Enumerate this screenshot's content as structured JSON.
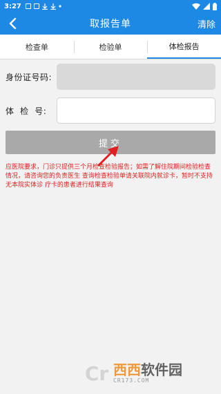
{
  "status_bar": {
    "time": "3:27",
    "left_icons": [
      "sim-icon",
      "sim-icon",
      "download-icon",
      "download-icon",
      "dot-icon"
    ],
    "right_icons": [
      "wifi-icon",
      "signal-icon",
      "battery-icon"
    ]
  },
  "header": {
    "back_icon": "chevron-left-icon",
    "title": "取报告单",
    "clear_label": "清除"
  },
  "tabs": [
    {
      "label": "检查单",
      "active": false
    },
    {
      "label": "检验单",
      "active": false
    },
    {
      "label": "体检报告",
      "active": true
    }
  ],
  "form": {
    "id_label": "身份证号码:",
    "id_value": "",
    "exam_label": "体  检  号:",
    "exam_value": ""
  },
  "submit_label": "提交",
  "notice": "应医院要求，门诊只提供三个月检查检验报告；如需了解住院期间检验检查情况，请咨询您的负责医生 查询检查检验单请关联院内就诊卡，暂时不支持无本院实体诊 疗卡的患者进行结果查询",
  "watermark": {
    "logo_glyph": "Cr",
    "name_a": "西西",
    "name_b": "软件园",
    "url": "CR173.COM"
  },
  "colors": {
    "brand": "#1e88e5",
    "notice": "#e02020",
    "button": "#a9a9a9"
  }
}
